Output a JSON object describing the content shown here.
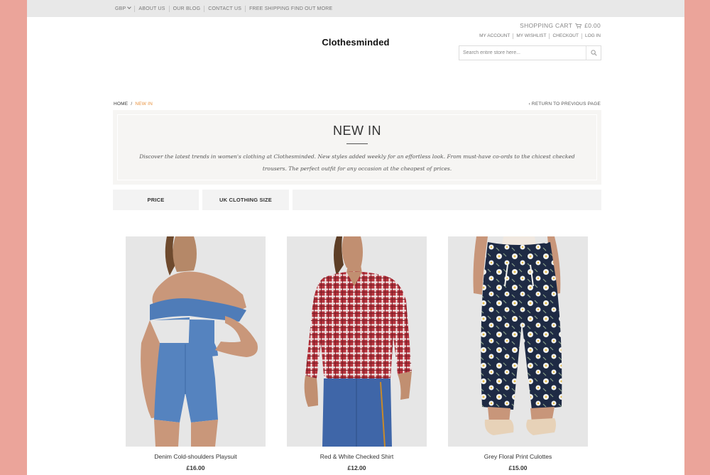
{
  "colors": {
    "accent": "#e8903a",
    "frame": "#eba49a",
    "topbar": "#e8e8e8",
    "hero_bg": "#f6f5f3"
  },
  "topbar": {
    "currency": "GBP",
    "links": [
      "ABOUT US",
      "OUR BLOG",
      "CONTACT US",
      "FREE SHIPPING FIND OUT MORE"
    ]
  },
  "header": {
    "logo": "Clothesminded",
    "cart_label": "SHOPPING CART",
    "cart_total": "£0.00",
    "account_links": [
      "MY ACCOUNT",
      "MY WISHLIST",
      "CHECKOUT",
      "LOG IN"
    ],
    "search_placeholder": "Search entire store here..."
  },
  "breadcrumb": {
    "home": "HOME",
    "separator": "/",
    "current": "NEW IN",
    "return_link": "‹ RETURN TO PREVIOUS PAGE"
  },
  "category": {
    "title": "NEW IN",
    "description": "Discover the latest trends in women's clothing at Clothesminded. New styles added weekly for an effortless look. From must-have co-ords to the chicest checked trousers. The perfect outfit for any occasion at the cheapest of prices."
  },
  "filters": {
    "price": "PRICE",
    "size": "UK CLOTHING SIZE"
  },
  "products": [
    {
      "name": "Denim Cold-shoulders Playsuit",
      "price": "£16.00"
    },
    {
      "name": "Red & White Checked Shirt",
      "price": "£12.00"
    },
    {
      "name": "Grey Floral Print Culottes",
      "price": "£15.00"
    }
  ]
}
